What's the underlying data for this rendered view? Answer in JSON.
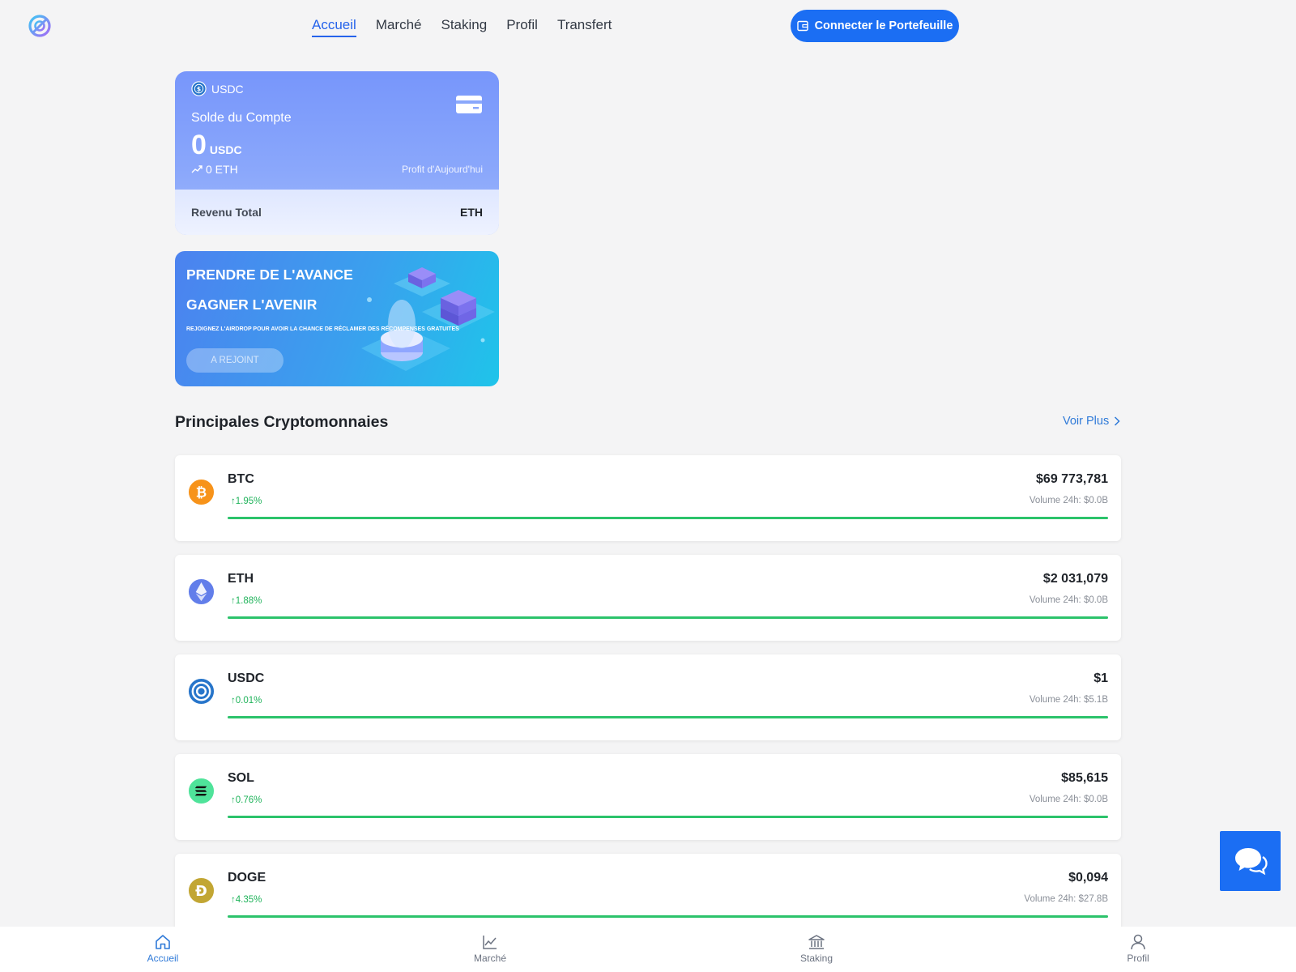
{
  "header": {
    "nav": [
      "Accueil",
      "Marché",
      "Staking",
      "Profil",
      "Transfert"
    ],
    "active_nav": "Accueil",
    "connect_label": "Connecter le Portefeuille"
  },
  "balance_card": {
    "token": "USDC",
    "label": "Solde du Compte",
    "amount": "0",
    "amount_unit": "USDC",
    "eth_value": "0 ETH",
    "profit_label": "Profit d'Aujourd'hui",
    "total_label": "Revenu Total",
    "total_value": "ETH"
  },
  "promo": {
    "title_1": "PRENDRE DE L'AVANCE",
    "title_2": "GAGNER L'AVENIR",
    "subtitle": "REJOIGNEZ L'AIRDROP POUR AVOIR LA CHANCE DE RÉCLAMER DES RÉCOMPENSES GRATUITES",
    "button": "A REJOINT"
  },
  "section": {
    "title": "Principales Cryptomonnaies",
    "more": "Voir Plus"
  },
  "coins": [
    {
      "symbol": "BTC",
      "change": "↑1.95%",
      "price": "$69 773,781",
      "volume": "Volume 24h: $0.0B",
      "icon_color": "#f7931a",
      "progress": 1.0
    },
    {
      "symbol": "ETH",
      "change": "↑1.88%",
      "price": "$2 031,079",
      "volume": "Volume 24h: $0.0B",
      "icon_color": "#627eea",
      "progress": 1.0
    },
    {
      "symbol": "USDC",
      "change": "↑0.01%",
      "price": "$1",
      "volume": "Volume 24h: $5.1B",
      "icon_color": "#2775ca",
      "progress": 1.0
    },
    {
      "symbol": "SOL",
      "change": "↑0.76%",
      "price": "$85,615",
      "volume": "Volume 24h: $0.0B",
      "icon_color": "#4fe39a",
      "progress": 1.0
    },
    {
      "symbol": "DOGE",
      "change": "↑4.35%",
      "price": "$0,094",
      "volume": "Volume 24h: $27.8B",
      "icon_color": "#c2a633",
      "progress": 1.0
    }
  ],
  "bottom_nav": [
    {
      "label": "Accueil",
      "icon": "home-icon",
      "active": true
    },
    {
      "label": "Marché",
      "icon": "chart-icon",
      "active": false
    },
    {
      "label": "Staking",
      "icon": "bank-icon",
      "active": false
    },
    {
      "label": "Profil",
      "icon": "user-icon",
      "active": false
    }
  ],
  "colors": {
    "accent": "#1b6ef3",
    "link": "#2f7ad8",
    "positive": "#1fb35a",
    "progress": "#2cc36b"
  }
}
